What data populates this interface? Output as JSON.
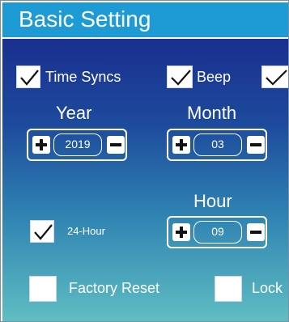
{
  "header": {
    "title": "Basic Setting"
  },
  "options": {
    "time_syncs": {
      "label": "Time Syncs",
      "checked": true
    },
    "beep": {
      "label": "Beep",
      "checked": true
    },
    "third": {
      "checked": true
    },
    "hour_24": {
      "label": "24-Hour",
      "checked": true
    },
    "factory_reset": {
      "label": "Factory Reset",
      "checked": false
    },
    "lock": {
      "label": "Lock",
      "checked": false
    }
  },
  "year": {
    "label": "Year",
    "value": "2019",
    "plus": "+",
    "minus": "−"
  },
  "month": {
    "label": "Month",
    "value": "03",
    "plus": "+",
    "minus": "−"
  },
  "hour": {
    "label": "Hour",
    "value": "09",
    "plus": "+",
    "minus": "−"
  },
  "icons": {
    "check": "check-icon",
    "plus": "plus-icon",
    "minus": "minus-icon"
  },
  "colors": {
    "header": "#1e9bd4",
    "panel_top": "#1a2f8f",
    "panel_bottom": "#5fbec2",
    "text": "#ffffff"
  }
}
